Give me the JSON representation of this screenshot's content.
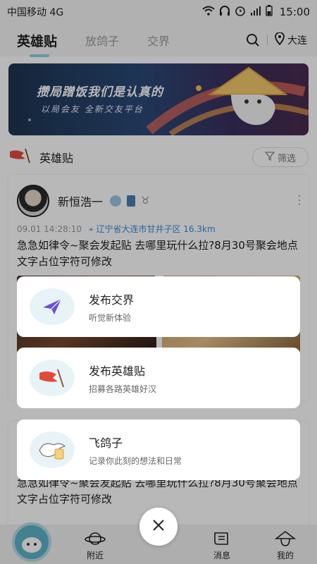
{
  "status_bar": {
    "carrier": "中国移动 4G",
    "time": "15:00"
  },
  "top_nav": {
    "tabs": [
      {
        "label": "英雄贴",
        "active": true
      },
      {
        "label": "放鸽子",
        "active": false
      },
      {
        "label": "交界",
        "active": false
      }
    ],
    "location": "大连"
  },
  "banner": {
    "title": "攒局蹭饭我们是认真的",
    "subtitle": "以局会友 全新交友平台"
  },
  "section": {
    "title": "英雄贴",
    "filter_label": "筛选"
  },
  "post": {
    "user_name": "新恒浩一",
    "timestamp": "09.01 14:28:10",
    "location": "辽宁省大连市甘井子区 16.3km",
    "content": "急急如律令~聚会发起贴 去哪里玩什么拉?8月30号聚会地点文字占位字符可修改"
  },
  "post2": {
    "content": "急急如律令~聚会发起贴 去哪里玩什么拉?8月30号聚会地点文字占位字符可修改"
  },
  "actions": [
    {
      "title": "发布交界",
      "subtitle": "听觉新体验",
      "icon": "paper-plane-icon"
    },
    {
      "title": "发布英雄贴",
      "subtitle": "招募各路英雄好汉",
      "icon": "banner-flag-icon"
    },
    {
      "title": "飞鸽子",
      "subtitle": "记录你此刻的想法和日常",
      "icon": "pigeon-icon"
    }
  ],
  "bottom_nav": {
    "items": [
      {
        "label": ""
      },
      {
        "label": "附近"
      },
      {
        "label": ""
      },
      {
        "label": "消息"
      },
      {
        "label": "我的"
      }
    ]
  },
  "colors": {
    "accent": "#5fb3c8",
    "location_blue": "#3a8dd8",
    "banner_bg": "#2b4a78"
  }
}
